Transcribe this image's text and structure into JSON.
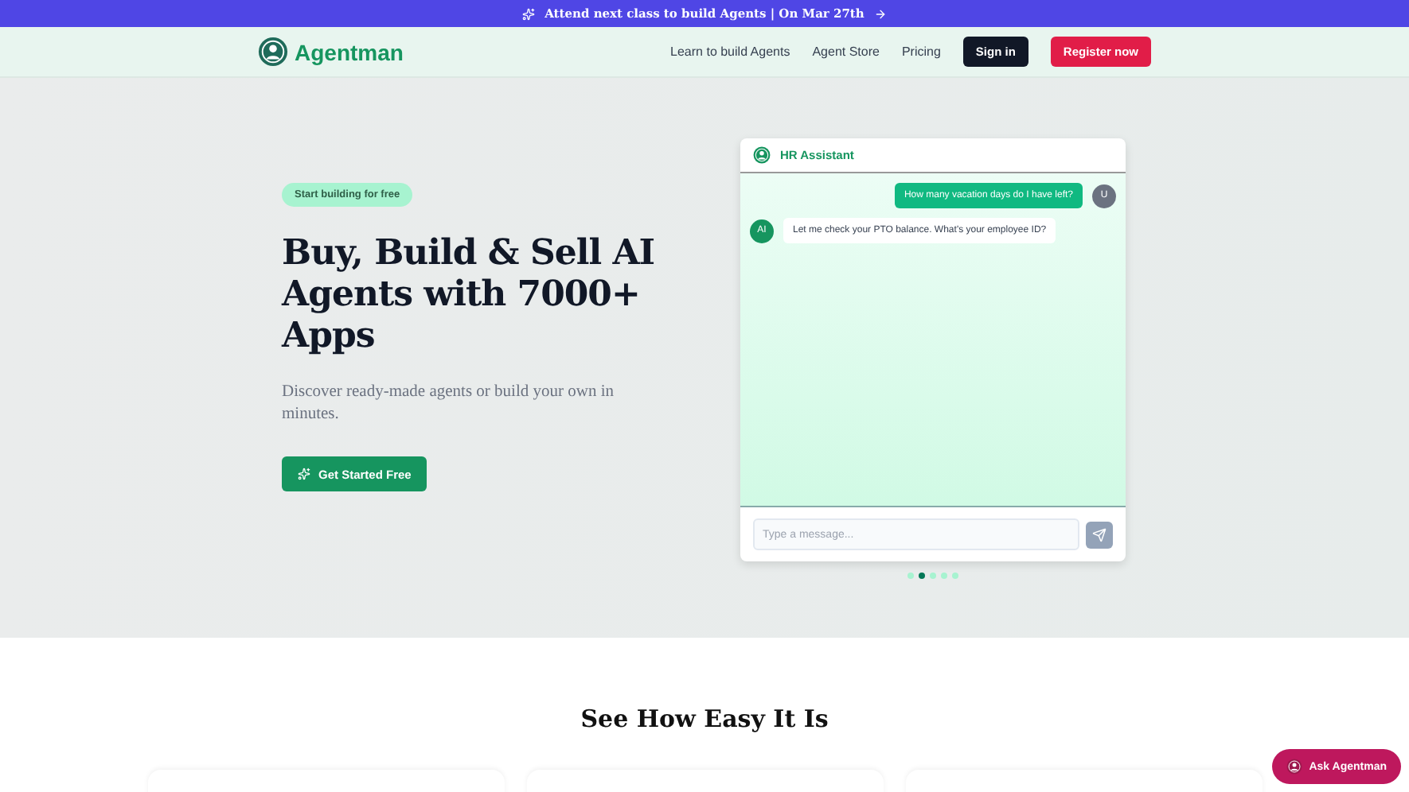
{
  "banner": {
    "text": "Attend next class to build Agents | On Mar 27th"
  },
  "nav": {
    "brand": "Agentman",
    "links": [
      "Learn to build Agents",
      "Agent Store",
      "Pricing"
    ],
    "sign_in": "Sign in",
    "register": "Register now"
  },
  "hero": {
    "badge": "Start building for free",
    "title": "Buy, Build & Sell AI Agents with 7000+ Apps",
    "subtitle": "Discover ready-made agents or build your own in minutes.",
    "cta": "Get Started Free"
  },
  "chat": {
    "title": "HR Assistant",
    "messages": [
      {
        "kind": "user",
        "avatar": "U",
        "text": "How many vacation days do I have left?"
      },
      {
        "kind": "ai",
        "avatar": "AI",
        "text": "Let me check your PTO balance. What's your employee ID?"
      }
    ],
    "input": {
      "placeholder": "Type a message..."
    },
    "dots": [
      {
        "selected": false
      },
      {
        "selected": true
      },
      {
        "selected": false
      },
      {
        "selected": false
      },
      {
        "selected": false
      }
    ]
  },
  "section": {
    "title": "See How Easy It Is"
  },
  "ask_button": "Ask Agentman"
}
